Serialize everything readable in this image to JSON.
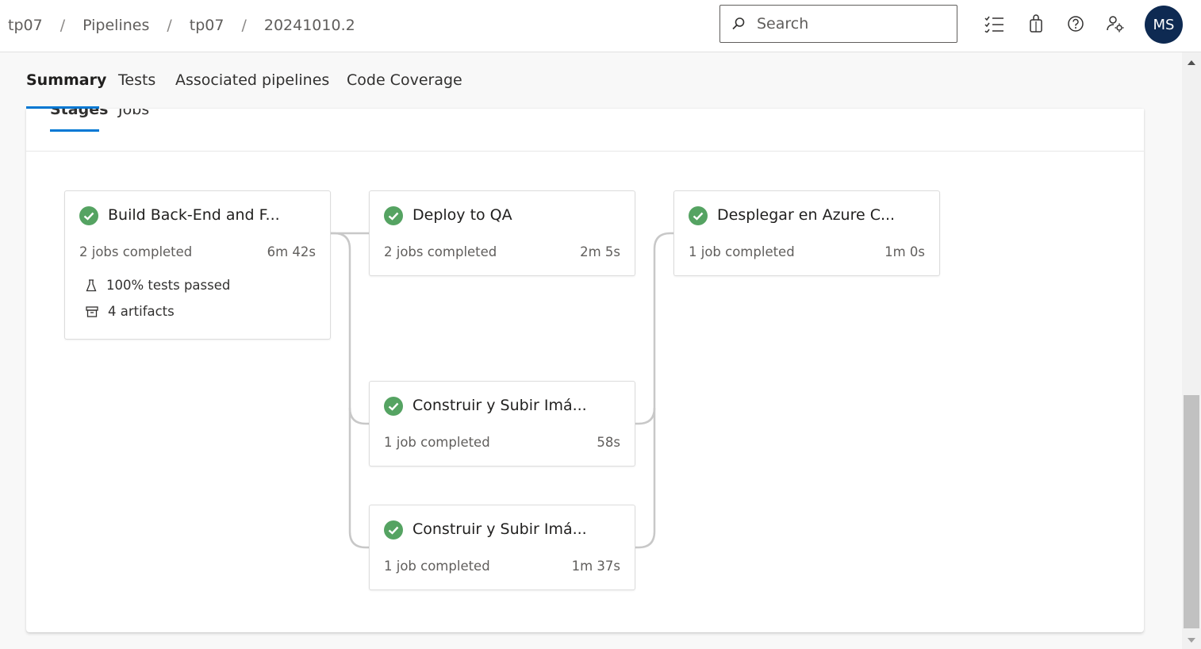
{
  "breadcrumb": [
    "tp07",
    "Pipelines",
    "tp07",
    "20241010.2"
  ],
  "breadcrumb_separator": "/",
  "search": {
    "placeholder": "Search"
  },
  "user": {
    "initials": "MS"
  },
  "tabs": [
    {
      "label": "Summary",
      "active": true
    },
    {
      "label": "Tests"
    },
    {
      "label": "Associated pipelines"
    },
    {
      "label": "Code Coverage"
    }
  ],
  "subtabs": [
    {
      "label": "Stages",
      "active": true
    },
    {
      "label": "Jobs"
    }
  ],
  "stages": [
    {
      "title": "Build Back-End and F...",
      "status": "succeeded",
      "jobs": "2 jobs completed",
      "duration": "6m 42s",
      "tests": "100% tests passed",
      "artifacts": "4 artifacts"
    },
    {
      "title": "Deploy to QA",
      "status": "succeeded",
      "jobs": "2 jobs completed",
      "duration": "2m 5s"
    },
    {
      "title": "Desplegar en Azure C...",
      "status": "succeeded",
      "jobs": "1 job completed",
      "duration": "1m 0s"
    },
    {
      "title": "Construir y Subir Imá...",
      "status": "succeeded",
      "jobs": "1 job completed",
      "duration": "58s"
    },
    {
      "title": "Construir y Subir Imá...",
      "status": "succeeded",
      "jobs": "1 job completed",
      "duration": "1m 37s"
    }
  ],
  "colors": {
    "accent": "#0078d4",
    "success": "#55a362",
    "avatar_bg": "#0e2a52",
    "connector": "#c8c8c8"
  },
  "icons": [
    "search-icon",
    "task-list-icon",
    "marketplace-bag-icon",
    "help-icon",
    "user-settings-icon",
    "success-check-icon",
    "beaker-icon",
    "artifact-box-icon"
  ]
}
